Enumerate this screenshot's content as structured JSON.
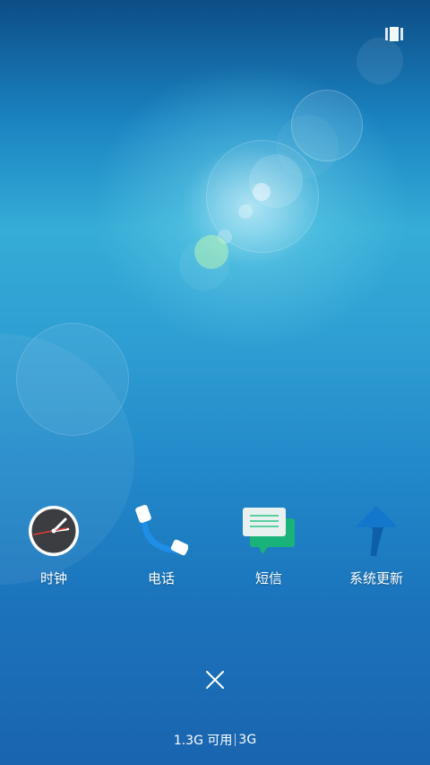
{
  "apps": [
    {
      "label": "时钟",
      "icon": "clock-icon"
    },
    {
      "label": "电话",
      "icon": "phone-icon"
    },
    {
      "label": "短信",
      "icon": "message-icon"
    },
    {
      "label": "系统更新",
      "icon": "system-update-icon"
    }
  ],
  "recent_toggle_icon": "grid-view-icon",
  "close_icon": "close-icon",
  "memory": {
    "available": "1.3G 可用",
    "total": "3G"
  },
  "colors": {
    "clock_face": "#3b3d40",
    "phone_handset": "#1e8ee6",
    "message_back": "#19b37a",
    "message_front": "#e8f1ef",
    "update_arrow": "#1378cc"
  }
}
